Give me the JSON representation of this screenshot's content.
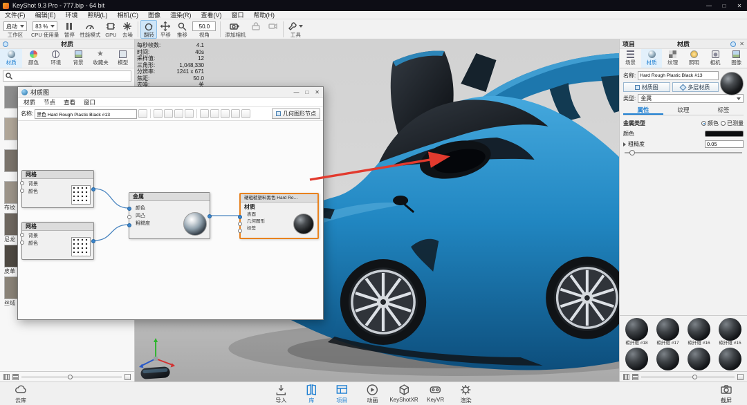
{
  "colors": {
    "accent": "#1e7fd2",
    "node_selection": "#e8821e",
    "car_blue": "#1f7fb5",
    "arrow_red": "#e23a2e"
  },
  "titlebar": {
    "title": "KeyShot 9.3 Pro  - 777.bip  - 64 bit",
    "minimize": "—",
    "maximize": "□",
    "close": "✕"
  },
  "menubar": {
    "items": [
      "文件(F)",
      "编辑(E)",
      "环境",
      "照明(L)",
      "相机(C)",
      "图像",
      "渲染(R)",
      "查看(V)",
      "窗口",
      "帮助(H)"
    ]
  },
  "toolbar": {
    "workspace": {
      "value": "启动",
      "label": "工作区"
    },
    "cpu": {
      "value": "83 %",
      "label": "CPU 使用量"
    },
    "pause": {
      "label": "暂停"
    },
    "perf": {
      "label": "性能模式"
    },
    "gpu": {
      "label": "GPU"
    },
    "denoise": {
      "label": "去噪"
    },
    "tumble": {
      "label": "翻转"
    },
    "pan": {
      "label": "平移"
    },
    "dolly": {
      "label": "推移"
    },
    "fov": {
      "value": "50.0",
      "label": "视角"
    },
    "add_camera": {
      "label": "添加相机"
    },
    "tools": {
      "label": "工具"
    }
  },
  "library_panel": {
    "title": "材质",
    "tabs": [
      "材质",
      "颜色",
      "环境",
      "背景",
      "收藏夹",
      "模型"
    ],
    "items": [
      "",
      "",
      "",
      "布纹",
      "尼龙",
      "皮革",
      "丝绒"
    ]
  },
  "viewport": {
    "stats": [
      {
        "label": "每秒帧数:",
        "value": "4.1"
      },
      {
        "label": "时间:",
        "value": "40s"
      },
      {
        "label": "采样值:",
        "value": "12"
      },
      {
        "label": "三角形:",
        "value": "1,048,330"
      },
      {
        "label": "分辨率:",
        "value": "1241 x 671"
      },
      {
        "label": "焦距:",
        "value": "50.0"
      },
      {
        "label": "去噪:",
        "value": "关"
      }
    ]
  },
  "material_graph": {
    "title": "材质图",
    "menus": [
      "材质",
      "节点",
      "查看",
      "窗口"
    ],
    "name_label": "名称:",
    "name_value": "黑色 Hard Rough Plastic Black #13",
    "geometry_node_button": "几何图形节点",
    "nodes": {
      "grid1": {
        "title": "网格",
        "rows": [
          "背景",
          "颜色"
        ]
      },
      "grid2": {
        "title": "网格",
        "rows": [
          "背景",
          "颜色"
        ]
      },
      "metal": {
        "title": "金属",
        "rows": [
          "颜色",
          "凹凸",
          "粗糙度"
        ]
      },
      "material": {
        "name": "硬粗糙塑料黑色 Hard Ro…",
        "title": "材质",
        "rows": [
          "表面",
          "几何图形",
          "标签"
        ]
      }
    }
  },
  "project_panel": {
    "title": "项目",
    "header_tab": "材质",
    "tabs": [
      "场景",
      "材质",
      "纹理",
      "照明",
      "相机",
      "图像"
    ],
    "name_label": "名称:",
    "name_value": "Hard Rough Plastic Black #13",
    "graph_button": "材质图",
    "multi_button": "多层材质",
    "type_label": "类型:",
    "type_value": "金属",
    "subtabs": [
      "属性",
      "纹理",
      "标签"
    ],
    "metal_type_label": "金属类型",
    "radio_color": "颜色",
    "radio_measured": "已测量",
    "color_label": "颜色",
    "roughness_label": "粗糙度",
    "roughness_value": "0.05",
    "library": [
      "碳纤维 #18",
      "碳纤维 #17",
      "碳纤维 #16",
      "碳纤维 #15",
      "",
      "",
      "",
      ""
    ]
  },
  "bottom_bar": {
    "cloud": "云库",
    "items": [
      {
        "label": "导入",
        "active": false
      },
      {
        "label": "库",
        "active": true
      },
      {
        "label": "项目",
        "active": true
      },
      {
        "label": "动画",
        "active": false
      },
      {
        "label": "KeyShotXR",
        "active": false
      },
      {
        "label": "KeyVR",
        "active": false
      },
      {
        "label": "渲染",
        "active": false
      }
    ],
    "screenshot": "截屏"
  }
}
